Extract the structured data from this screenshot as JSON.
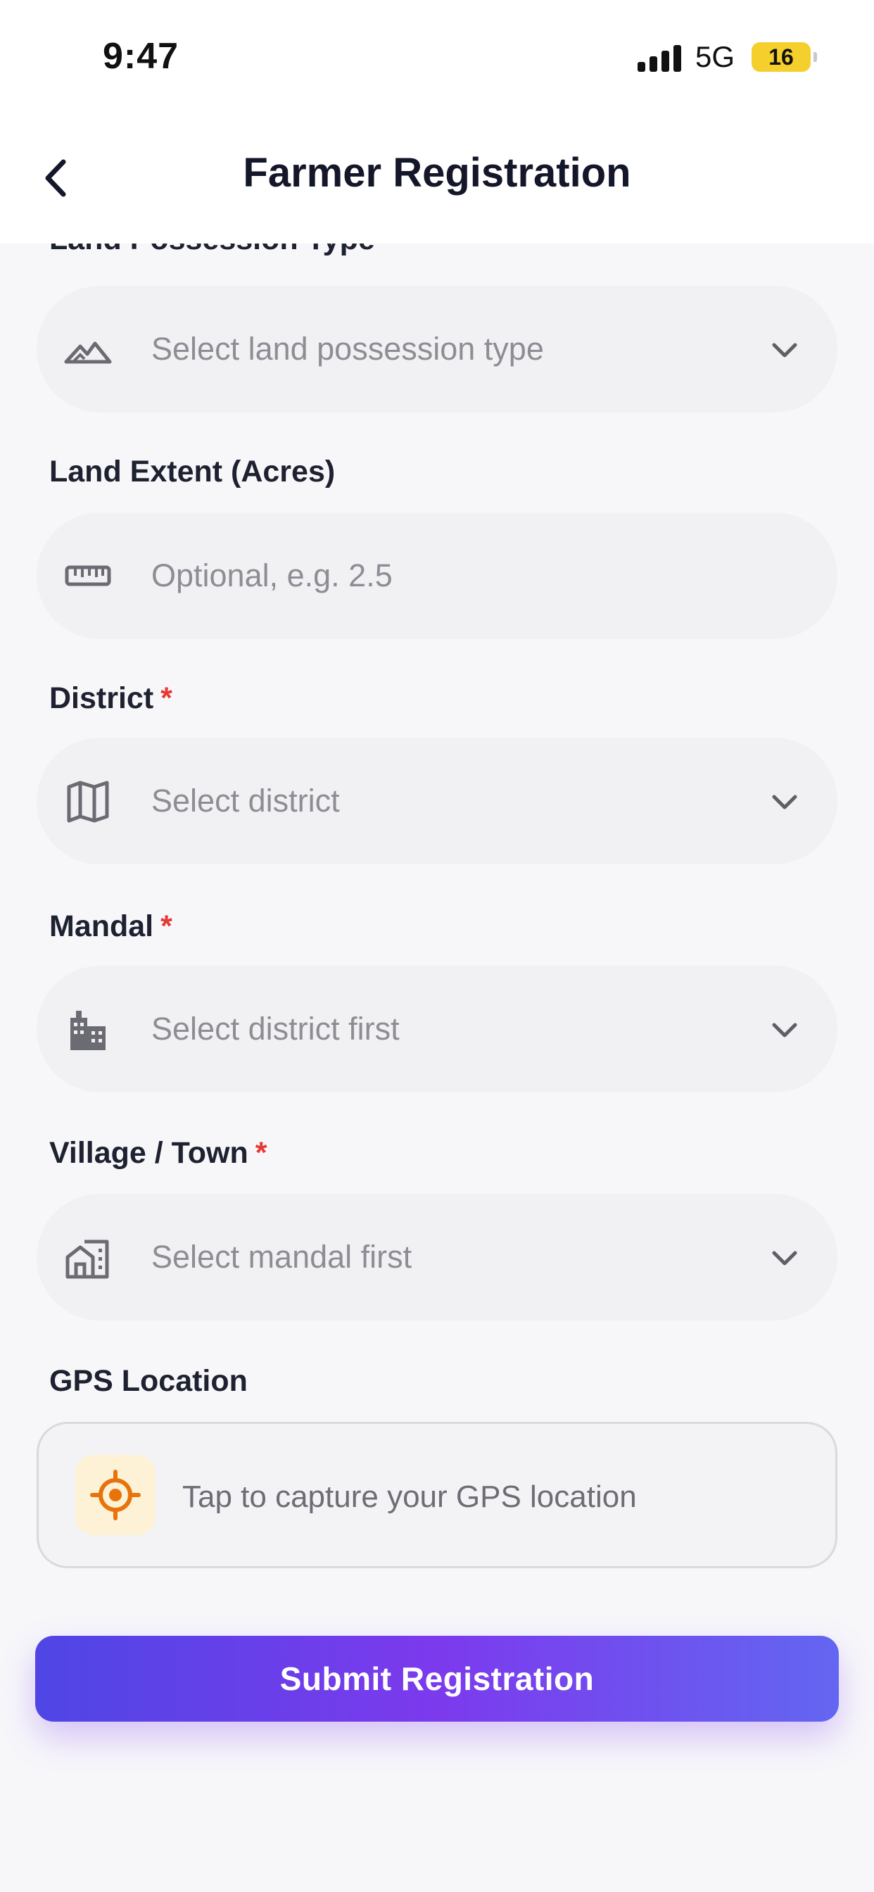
{
  "status_bar": {
    "time": "9:47",
    "network": "5G",
    "battery": "16"
  },
  "header": {
    "title": "Farmer Registration",
    "back_icon": "chevron-left-icon"
  },
  "form": {
    "land_possession": {
      "label": "Land Possession Type",
      "required_mark": "*",
      "placeholder": "Select land possession type",
      "icon": "landscape-icon"
    },
    "land_extent": {
      "label": "Land Extent (Acres)",
      "placeholder": "Optional, e.g. 2.5",
      "icon": "ruler-icon"
    },
    "district": {
      "label": "District",
      "required_mark": "*",
      "placeholder": "Select district",
      "icon": "map-icon"
    },
    "mandal": {
      "label": "Mandal",
      "required_mark": "*",
      "placeholder": "Select district first",
      "icon": "buildings-icon"
    },
    "village": {
      "label": "Village / Town",
      "required_mark": "*",
      "placeholder": "Select mandal first",
      "icon": "house-city-icon"
    },
    "gps": {
      "label": "GPS Location",
      "prompt": "Tap to capture your GPS location",
      "icon": "gps-target-icon"
    }
  },
  "submit_label": "Submit Registration",
  "colors": {
    "accent_start": "#4f46e5",
    "accent_mid": "#7c3aed",
    "accent_end": "#6366f1",
    "required": "#e53935",
    "gps_icon": "#e8730c"
  }
}
